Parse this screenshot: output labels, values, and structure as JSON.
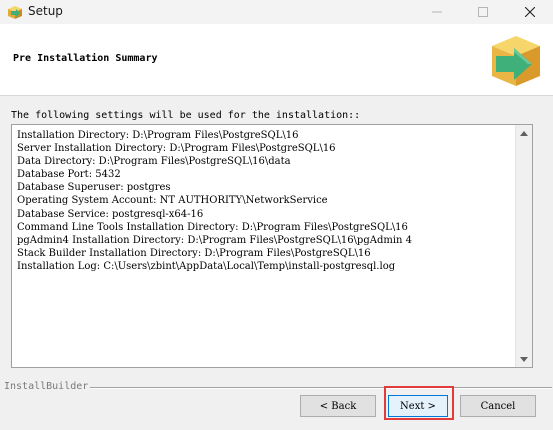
{
  "window": {
    "title": "Setup",
    "icon": "installer-box-icon"
  },
  "header": {
    "title": "Pre Installation Summary",
    "logo": "installer-arrow-box-icon"
  },
  "intro_text": "The following settings will be used for the installation::",
  "summary": {
    "lines": [
      "Installation Directory: D:\\Program Files\\PostgreSQL\\16",
      "Server Installation Directory: D:\\Program Files\\PostgreSQL\\16",
      "Data Directory: D:\\Program Files\\PostgreSQL\\16\\data",
      "Database Port: 5432",
      "Database Superuser: postgres",
      "Operating System Account: NT AUTHORITY\\NetworkService",
      "Database Service: postgresql-x64-16",
      "Command Line Tools Installation Directory: D:\\Program Files\\PostgreSQL\\16",
      "pgAdmin4 Installation Directory: D:\\Program Files\\PostgreSQL\\16\\pgAdmin 4",
      "Stack Builder Installation Directory: D:\\Program Files\\PostgreSQL\\16",
      "Installation Log: C:\\Users\\zbint\\AppData\\Local\\Temp\\install-postgresql.log"
    ]
  },
  "footer": {
    "brand": "InstallBuilder",
    "back_label": "< Back",
    "next_label": "Next >",
    "cancel_label": "Cancel"
  },
  "colors": {
    "highlight": "#e23b3b",
    "logo_green": "#3fb079",
    "logo_yellow": "#f2c84b"
  }
}
